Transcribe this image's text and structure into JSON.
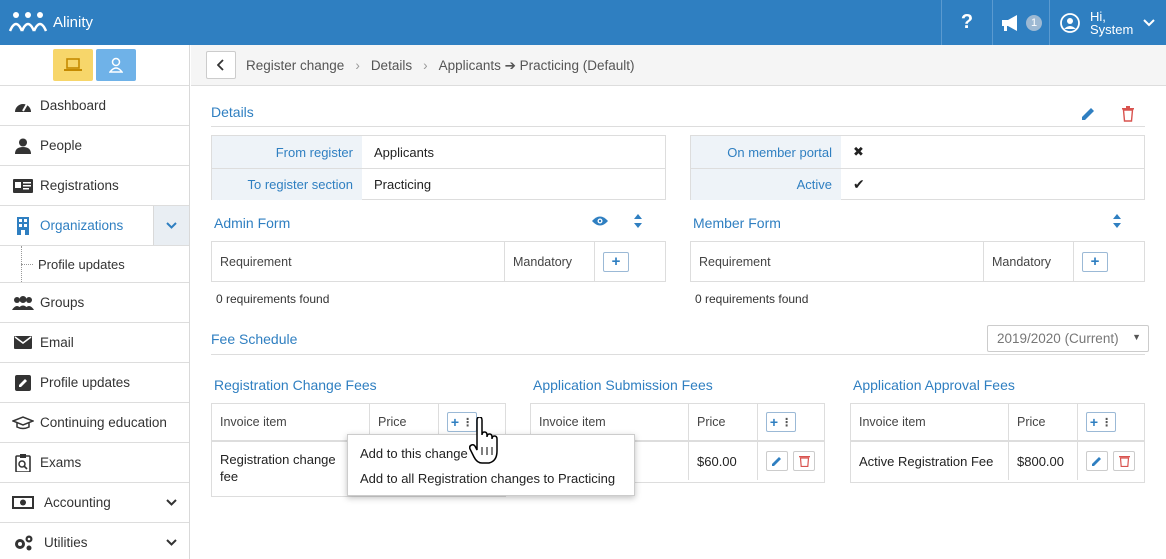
{
  "app": {
    "title": "Alinity"
  },
  "topbar": {
    "help_icon": "question-icon",
    "notifications_count": "1",
    "user_greeting_line1": "Hi,",
    "user_greeting_line2": "System"
  },
  "sidebar": {
    "role_buttons": [
      "laptop-icon",
      "user-icon"
    ],
    "items": [
      {
        "label": "Dashboard",
        "icon": "dashboard-icon"
      },
      {
        "label": "People",
        "icon": "person-icon"
      },
      {
        "label": "Registrations",
        "icon": "id-card-icon"
      },
      {
        "label": "Organizations",
        "icon": "building-icon",
        "active": true
      },
      {
        "label": "Profile updates",
        "sub": true
      },
      {
        "label": "Groups",
        "icon": "users-icon"
      },
      {
        "label": "Email",
        "icon": "envelope-icon"
      },
      {
        "label": "Profile updates",
        "icon": "edit-icon"
      },
      {
        "label": "Continuing education",
        "icon": "graduation-cap-icon"
      },
      {
        "label": "Exams",
        "icon": "exam-icon"
      },
      {
        "label": "Accounting",
        "icon": "money-icon"
      },
      {
        "label": "Utilities",
        "icon": "gears-icon"
      }
    ]
  },
  "breadcrumb": {
    "items": [
      "Register change",
      "Details",
      "Applicants ➔ Practicing (Default)"
    ]
  },
  "details": {
    "title": "Details",
    "from_register_label": "From register",
    "from_register_value": "Applicants",
    "to_section_label": "To register section",
    "to_section_value": "Practicing",
    "member_portal_label": "On member portal",
    "member_portal_value": "✖",
    "active_label": "Active",
    "active_value": "✔"
  },
  "admin_form": {
    "title": "Admin Form",
    "col_requirement": "Requirement",
    "col_mandatory": "Mandatory",
    "found": "0 requirements found"
  },
  "member_form": {
    "title": "Member Form",
    "col_requirement": "Requirement",
    "col_mandatory": "Mandatory",
    "found": "0 requirements found"
  },
  "fee_schedule": {
    "title": "Fee Schedule",
    "year_selected": "2019/2020 (Current)"
  },
  "registration_change_fees": {
    "title": "Registration Change Fees",
    "col_item": "Invoice item",
    "col_price": "Price",
    "row_item_line1": "Registration change",
    "row_item_line2": "fee"
  },
  "application_submission_fees": {
    "title": "Application Submission Fees",
    "col_item": "Invoice item",
    "col_price": "Price",
    "row_item_tail": "ee",
    "row_price": "$60.00"
  },
  "application_approval_fees": {
    "title": "Application Approval Fees",
    "col_item": "Invoice item",
    "col_price": "Price",
    "row_item": "Active Registration Fee",
    "row_price": "$800.00"
  },
  "add_menu": {
    "option1": "Add to this change",
    "option2": "Add to all Registration changes to Practicing"
  },
  "colors": {
    "primary": "#2f7fc1",
    "role_laptop": "#f7d66a",
    "role_user": "#6fb2e8",
    "delete": "#d9534f"
  }
}
